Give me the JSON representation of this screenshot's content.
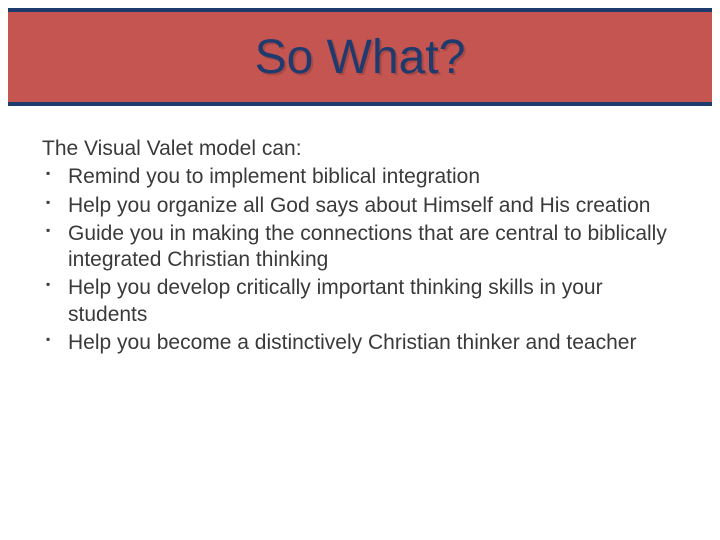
{
  "title": "So What?",
  "intro": "The Visual Valet model can:",
  "bullets": [
    "Remind you to implement biblical integration",
    "Help you organize all God says about Himself and His creation",
    "Guide you in making the connections that are central to biblically integrated Christian thinking",
    "Help you develop critically important thinking skills in your students",
    "Help you become a distinctively Christian thinker and teacher"
  ]
}
